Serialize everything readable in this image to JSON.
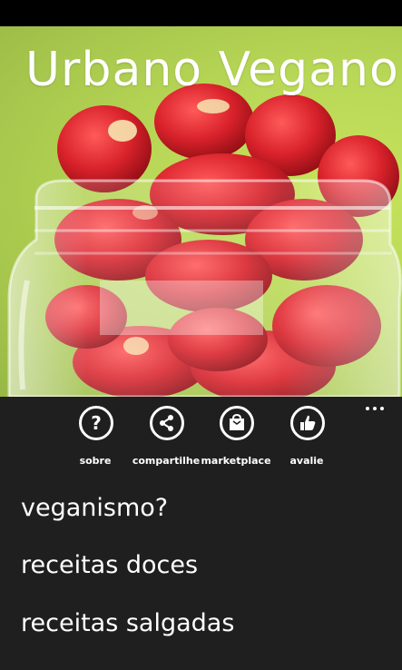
{
  "hero": {
    "title": "Urbano Vegano"
  },
  "app_bar": {
    "buttons": [
      {
        "label": "sobre",
        "icon": "question-icon"
      },
      {
        "label": "compartilhe",
        "icon": "share-icon"
      },
      {
        "label": "marketplace",
        "icon": "shopping-bag-icon"
      },
      {
        "label": "avalie",
        "icon": "thumbs-up-icon"
      }
    ],
    "more_icon": "ellipsis-icon"
  },
  "menu": {
    "items": [
      {
        "label": "veganismo?"
      },
      {
        "label": "receitas doces"
      },
      {
        "label": "receitas salgadas"
      }
    ]
  },
  "colors": {
    "background": "#1f1f1f",
    "accent_text": "#ffffff",
    "hero_green": "#b9d857",
    "strawberry": "#d6262e"
  }
}
